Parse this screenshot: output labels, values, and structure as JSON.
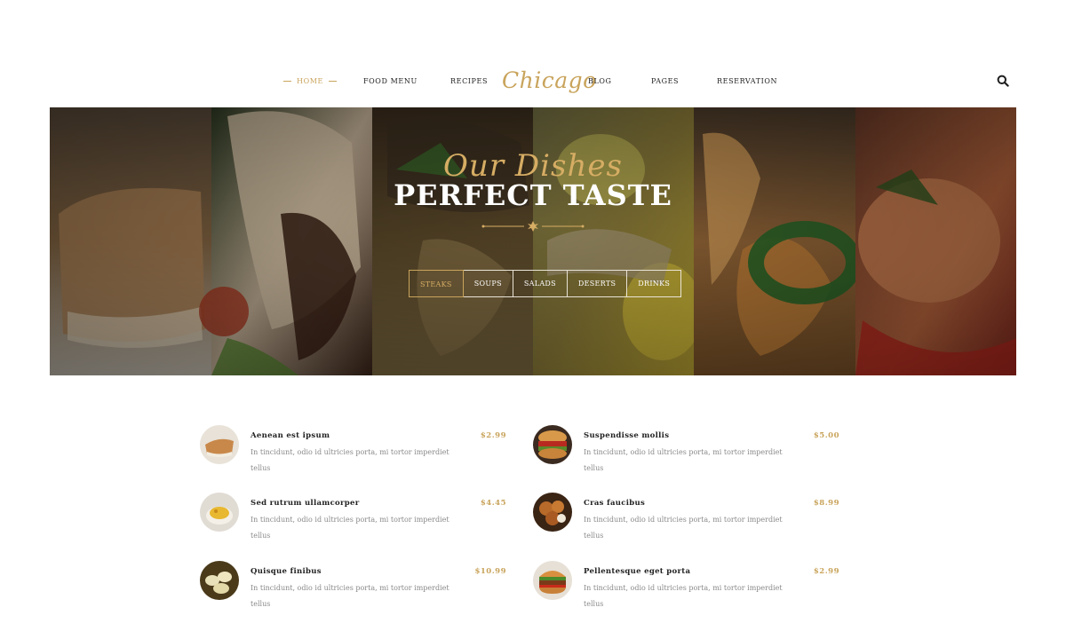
{
  "nav": {
    "items": [
      {
        "label": "HOME",
        "active": true
      },
      {
        "label": "FOOD MENU",
        "active": false
      },
      {
        "label": "RECIPES",
        "active": false
      },
      {
        "label": "BLOG",
        "active": false
      },
      {
        "label": "PAGES",
        "active": false
      },
      {
        "label": "RESERVATION",
        "active": false
      }
    ],
    "logo": "Chicago",
    "search_icon": "search-icon"
  },
  "hero": {
    "script_title": "Our Dishes",
    "title": "PERFECT TASTE",
    "tabs": [
      {
        "label": "STEAKS",
        "active": true
      },
      {
        "label": "SOUPS",
        "active": false
      },
      {
        "label": "SALADS",
        "active": false
      },
      {
        "label": "DESERTS",
        "active": false
      },
      {
        "label": "DRINKS",
        "active": false
      }
    ]
  },
  "menu": {
    "items": [
      {
        "name": "Aenean est ipsum",
        "price": "$2.99",
        "description": "In tincidunt, odio id ultricies porta, mi tortor imperdiet tellus"
      },
      {
        "name": "Suspendisse mollis",
        "price": "$5.00",
        "description": "In tincidunt, odio id ultricies porta, mi tortor imperdiet tellus"
      },
      {
        "name": "Sed rutrum ullamcorper",
        "price": "$4.45",
        "description": "In tincidunt, odio id ultricies porta, mi tortor imperdiet tellus"
      },
      {
        "name": "Cras faucibus",
        "price": "$8.99",
        "description": "In tincidunt, odio id ultricies porta, mi tortor imperdiet tellus"
      },
      {
        "name": "Quisque finibus",
        "price": "$10.99",
        "description": "In tincidunt, odio id ultricies porta, mi tortor imperdiet tellus"
      },
      {
        "name": "Pellentesque eget porta",
        "price": "$2.99",
        "description": "In tincidunt, odio id ultricies porta, mi tortor imperdiet tellus"
      }
    ]
  },
  "colors": {
    "accent": "#c9a45c",
    "text": "#222222",
    "muted": "#8a8a8a"
  }
}
